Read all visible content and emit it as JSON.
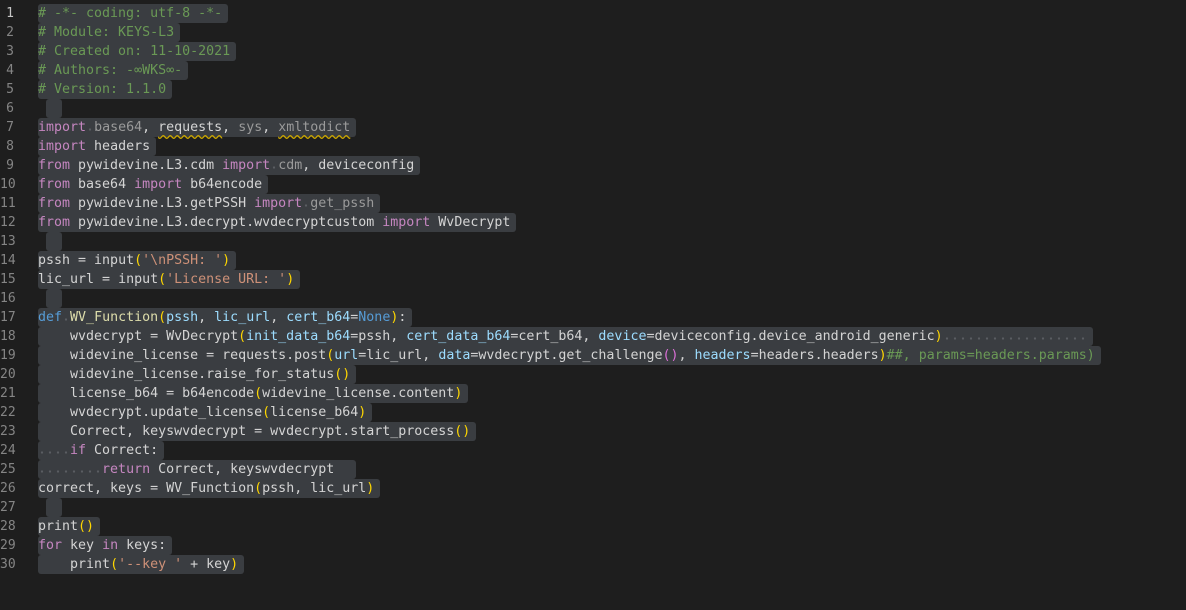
{
  "editor": {
    "active_line": 1,
    "colors": {
      "background": "#1e1e1e",
      "selection": "#3a3d41",
      "comment": "#6a9955",
      "keyword": "#c586c0"
    },
    "lines": [
      [
        [
          "comment",
          "# -*- coding: utf-8 -*-"
        ]
      ],
      [
        [
          "comment",
          "# Module: KEYS-L3"
        ]
      ],
      [
        [
          "comment",
          "# Created on: 11-10-2021"
        ]
      ],
      [
        [
          "comment",
          "# Authors: -∞WKS∞-"
        ]
      ],
      [
        [
          "comment",
          "# Version: 1.1.0"
        ]
      ],
      [],
      [
        [
          "kw",
          "import"
        ],
        [
          "txt",
          " "
        ],
        [
          "dim",
          "base64"
        ],
        [
          "txt",
          ", "
        ],
        [
          "txt squiggle",
          "requests"
        ],
        [
          "txt",
          ", "
        ],
        [
          "dim",
          "sys"
        ],
        [
          "txt",
          ", "
        ],
        [
          "dim squiggle",
          "xmltodict"
        ]
      ],
      [
        [
          "kw",
          "import"
        ],
        [
          "txt",
          " headers"
        ]
      ],
      [
        [
          "kw",
          "from"
        ],
        [
          "txt",
          " pywidevine.L3.cdm "
        ],
        [
          "kw",
          "import"
        ],
        [
          "txt",
          " "
        ],
        [
          "dim",
          "cdm"
        ],
        [
          "txt",
          ", deviceconfig"
        ]
      ],
      [
        [
          "kw",
          "from"
        ],
        [
          "txt",
          " base64 "
        ],
        [
          "kw",
          "import"
        ],
        [
          "txt",
          " b64encode"
        ]
      ],
      [
        [
          "kw",
          "from"
        ],
        [
          "txt",
          " pywidevine.L3.getPSSH "
        ],
        [
          "kw",
          "import"
        ],
        [
          "txt",
          " "
        ],
        [
          "dim",
          "get_pssh"
        ]
      ],
      [
        [
          "kw",
          "from"
        ],
        [
          "txt",
          " pywidevine.L3.decrypt.wvdecryptcustom "
        ],
        [
          "kw",
          "import"
        ],
        [
          "txt",
          " WvDecrypt"
        ]
      ],
      [],
      [
        [
          "txt",
          "pssh = "
        ],
        [
          "txt",
          "input"
        ],
        [
          "paren",
          "("
        ],
        [
          "str",
          "'\\nPSSH: '"
        ],
        [
          "paren",
          ")"
        ]
      ],
      [
        [
          "txt",
          "lic_url = "
        ],
        [
          "txt",
          "input"
        ],
        [
          "paren",
          "("
        ],
        [
          "str",
          "'License URL: '"
        ],
        [
          "paren",
          ")"
        ]
      ],
      [],
      [
        [
          "def",
          "def"
        ],
        [
          "txt",
          " "
        ],
        [
          "fn",
          "WV_Function"
        ],
        [
          "paren",
          "("
        ],
        [
          "var",
          "pssh"
        ],
        [
          "txt",
          ", "
        ],
        [
          "var",
          "lic_url"
        ],
        [
          "txt",
          ", "
        ],
        [
          "var",
          "cert_b64"
        ],
        [
          "txt",
          "="
        ],
        [
          "const",
          "None"
        ],
        [
          "paren",
          ")"
        ],
        [
          "txt",
          ":"
        ]
      ],
      [
        [
          "txt",
          "    wvdecrypt = WvDecrypt"
        ],
        [
          "paren",
          "("
        ],
        [
          "var",
          "init_data_b64"
        ],
        [
          "txt",
          "=pssh, "
        ],
        [
          "var",
          "cert_data_b64"
        ],
        [
          "txt",
          "=cert_b64, "
        ],
        [
          "var",
          "device"
        ],
        [
          "txt",
          "=deviceconfig.device_android_generic"
        ],
        [
          "paren",
          ")"
        ],
        [
          "txt",
          "                  "
        ]
      ],
      [
        [
          "txt",
          "    widevine_license = requests.post"
        ],
        [
          "paren",
          "("
        ],
        [
          "var",
          "url"
        ],
        [
          "txt",
          "=lic_url, "
        ],
        [
          "var",
          "data"
        ],
        [
          "txt",
          "=wvdecrypt.get_challenge"
        ],
        [
          "paren2",
          "()"
        ],
        [
          "txt",
          ", "
        ],
        [
          "var",
          "headers"
        ],
        [
          "txt",
          "=headers.headers"
        ],
        [
          "paren",
          ")"
        ],
        [
          "comment",
          "##, params=headers.params)"
        ]
      ],
      [
        [
          "txt",
          "    widevine_license.raise_for_status"
        ],
        [
          "paren",
          "()"
        ]
      ],
      [
        [
          "txt",
          "    license_b64 = b64encode"
        ],
        [
          "paren",
          "("
        ],
        [
          "txt",
          "widevine_license.content"
        ],
        [
          "paren",
          ")"
        ]
      ],
      [
        [
          "txt",
          "    wvdecrypt.update_license"
        ],
        [
          "paren",
          "("
        ],
        [
          "txt",
          "license_b64"
        ],
        [
          "paren",
          ")"
        ]
      ],
      [
        [
          "txt",
          "    Correct, keyswvdecrypt = wvdecrypt.start_process"
        ],
        [
          "paren",
          "()"
        ]
      ],
      [
        [
          "txt",
          "    "
        ],
        [
          "kw",
          "if"
        ],
        [
          "txt",
          " Correct:"
        ]
      ],
      [
        [
          "txt",
          "        "
        ],
        [
          "kw",
          "return"
        ],
        [
          "txt",
          " Correct, keyswvdecrypt  "
        ]
      ],
      [
        [
          "txt",
          "correct, keys = WV_Function"
        ],
        [
          "paren",
          "("
        ],
        [
          "txt",
          "pssh, lic_url"
        ],
        [
          "paren",
          ")"
        ]
      ],
      [],
      [
        [
          "txt",
          "print"
        ],
        [
          "paren",
          "()"
        ]
      ],
      [
        [
          "kw",
          "for"
        ],
        [
          "txt",
          " key "
        ],
        [
          "kw",
          "in"
        ],
        [
          "txt",
          " keys:"
        ]
      ],
      [
        [
          "txt",
          "    print"
        ],
        [
          "paren",
          "("
        ],
        [
          "str",
          "'--key '"
        ],
        [
          "txt",
          " + key"
        ],
        [
          "paren",
          ")"
        ]
      ]
    ]
  }
}
